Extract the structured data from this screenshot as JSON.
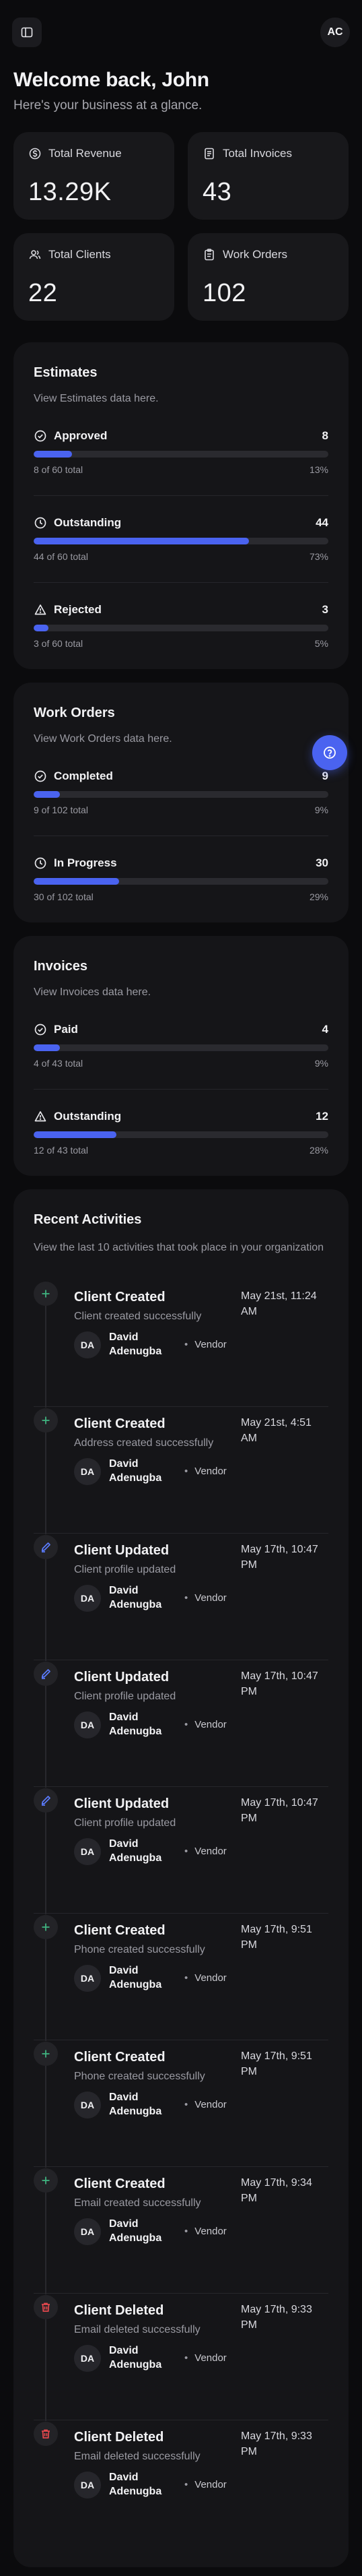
{
  "topbar": {
    "avatar_initials": "AC"
  },
  "welcome": {
    "title": "Welcome back, John",
    "subtitle": "Here's your business at a glance."
  },
  "stats": [
    {
      "label": "Total Revenue",
      "value": "13.29K",
      "icon": "dollar-icon"
    },
    {
      "label": "Total Invoices",
      "value": "43",
      "icon": "invoice-icon"
    },
    {
      "label": "Total Clients",
      "value": "22",
      "icon": "users-icon"
    },
    {
      "label": "Work Orders",
      "value": "102",
      "icon": "clipboard-icon"
    }
  ],
  "estimates": {
    "title": "Estimates",
    "subtitle": "View Estimates data here.",
    "items": [
      {
        "label": "Approved",
        "count": "8",
        "total": "8 of 60 total",
        "percent": "13%",
        "fill": 13,
        "icon": "check-circle-icon"
      },
      {
        "label": "Outstanding",
        "count": "44",
        "total": "44 of 60 total",
        "percent": "73%",
        "fill": 73,
        "icon": "clock-icon"
      },
      {
        "label": "Rejected",
        "count": "3",
        "total": "3 of 60 total",
        "percent": "5%",
        "fill": 5,
        "icon": "warning-icon"
      }
    ]
  },
  "work_orders": {
    "title": "Work Orders",
    "subtitle": "View Work Orders data here.",
    "items": [
      {
        "label": "Completed",
        "count": "9",
        "total": "9 of 102 total",
        "percent": "9%",
        "fill": 9,
        "icon": "check-circle-icon"
      },
      {
        "label": "In Progress",
        "count": "30",
        "total": "30 of 102 total",
        "percent": "29%",
        "fill": 29,
        "icon": "clock-icon"
      }
    ]
  },
  "invoices": {
    "title": "Invoices",
    "subtitle": "View Invoices data here.",
    "items": [
      {
        "label": "Paid",
        "count": "4",
        "total": "4 of 43 total",
        "percent": "9%",
        "fill": 9,
        "icon": "check-circle-icon"
      },
      {
        "label": "Outstanding",
        "count": "12",
        "total": "12 of 43 total",
        "percent": "28%",
        "fill": 28,
        "icon": "warning-icon"
      }
    ]
  },
  "recent": {
    "title": "Recent Activities",
    "subtitle": "View the last 10 activities that took place in your organization",
    "items": [
      {
        "title": "Client Created",
        "desc": "Client created successfully",
        "date": "May 21st, 11:24 AM",
        "initials": "DA",
        "name": "David Adenugba",
        "role": "Vendor",
        "icon": "plus-icon"
      },
      {
        "title": "Client Created",
        "desc": "Address created successfully",
        "date": "May 21st, 4:51 AM",
        "initials": "DA",
        "name": "David Adenugba",
        "role": "Vendor",
        "icon": "plus-icon"
      },
      {
        "title": "Client Updated",
        "desc": "Client profile updated",
        "date": "May 17th, 10:47 PM",
        "initials": "DA",
        "name": "David Adenugba",
        "role": "Vendor",
        "icon": "pencil-icon"
      },
      {
        "title": "Client Updated",
        "desc": "Client profile updated",
        "date": "May 17th, 10:47 PM",
        "initials": "DA",
        "name": "David Adenugba",
        "role": "Vendor",
        "icon": "pencil-icon"
      },
      {
        "title": "Client Updated",
        "desc": "Client profile updated",
        "date": "May 17th, 10:47 PM",
        "initials": "DA",
        "name": "David Adenugba",
        "role": "Vendor",
        "icon": "pencil-icon"
      },
      {
        "title": "Client Created",
        "desc": "Phone created successfully",
        "date": "May 17th, 9:51 PM",
        "initials": "DA",
        "name": "David Adenugba",
        "role": "Vendor",
        "icon": "plus-icon"
      },
      {
        "title": "Client Created",
        "desc": "Phone created successfully",
        "date": "May 17th, 9:51 PM",
        "initials": "DA",
        "name": "David Adenugba",
        "role": "Vendor",
        "icon": "plus-icon"
      },
      {
        "title": "Client Created",
        "desc": "Email created successfully",
        "date": "May 17th, 9:34 PM",
        "initials": "DA",
        "name": "David Adenugba",
        "role": "Vendor",
        "icon": "plus-icon"
      },
      {
        "title": "Client Deleted",
        "desc": "Email deleted successfully",
        "date": "May 17th, 9:33 PM",
        "initials": "DA",
        "name": "David Adenugba",
        "role": "Vendor",
        "icon": "trash-icon"
      },
      {
        "title": "Client Deleted",
        "desc": "Email deleted successfully",
        "date": "May 17th, 9:33 PM",
        "initials": "DA",
        "name": "David Adenugba",
        "role": "Vendor",
        "icon": "trash-icon"
      }
    ]
  },
  "colors": {
    "accent": "#4a63f0",
    "plus": "#3fb27f",
    "pencil": "#5b7cff",
    "trash": "#e5484d"
  }
}
